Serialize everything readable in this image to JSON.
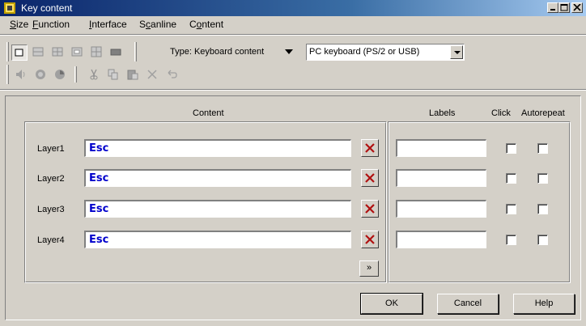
{
  "window": {
    "title": "Key content",
    "controls": [
      "minimize-icon",
      "maximize-icon",
      "close-icon"
    ]
  },
  "menu": [
    {
      "label": "Size",
      "mnemonic": "S"
    },
    {
      "label": "Function",
      "mnemonic": "F"
    },
    {
      "label": "Interface",
      "mnemonic": "I"
    },
    {
      "label": "Scanline",
      "mnemonic": "c"
    },
    {
      "label": "Content",
      "mnemonic": "o"
    }
  ],
  "toolbar": {
    "size_buttons": [
      "size-1x1-icon",
      "size-2x1-icon",
      "size-2x2-icon",
      "size-grid-icon",
      "size-grid-large-icon",
      "size-wide-icon"
    ],
    "type_button": "Type: Keyboard content",
    "interface_combo": "PC keyboard (PS/2 or USB)",
    "edit_buttons": [
      "speaker-icon",
      "record-icon",
      "stop-icon",
      "cut-icon",
      "copy-icon",
      "paste-icon",
      "delete-icon",
      "undo-icon"
    ]
  },
  "columns": {
    "content": "Content",
    "labels": "Labels",
    "click": "Click",
    "autorepeat": "Autorepeat"
  },
  "layers": [
    {
      "label": "Layer1",
      "content": "Esc",
      "label_value": "",
      "click": false,
      "autorepeat": false
    },
    {
      "label": "Layer2",
      "content": "Esc",
      "label_value": "",
      "click": false,
      "autorepeat": false
    },
    {
      "label": "Layer3",
      "content": "Esc",
      "label_value": "",
      "click": false,
      "autorepeat": false
    },
    {
      "label": "Layer4",
      "content": "Esc",
      "label_value": "",
      "click": false,
      "autorepeat": false
    }
  ],
  "more_button": "»",
  "buttons": {
    "ok": "OK",
    "cancel": "Cancel",
    "help": "Help"
  }
}
